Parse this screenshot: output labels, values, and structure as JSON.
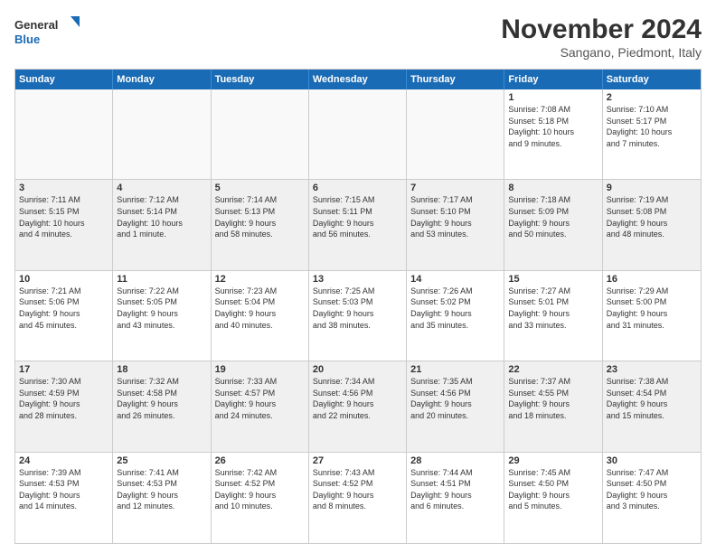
{
  "logo": {
    "line1": "General",
    "line2": "Blue"
  },
  "title": "November 2024",
  "location": "Sangano, Piedmont, Italy",
  "weekdays": [
    "Sunday",
    "Monday",
    "Tuesday",
    "Wednesday",
    "Thursday",
    "Friday",
    "Saturday"
  ],
  "weeks": [
    [
      {
        "day": "",
        "info": ""
      },
      {
        "day": "",
        "info": ""
      },
      {
        "day": "",
        "info": ""
      },
      {
        "day": "",
        "info": ""
      },
      {
        "day": "",
        "info": ""
      },
      {
        "day": "1",
        "info": "Sunrise: 7:08 AM\nSunset: 5:18 PM\nDaylight: 10 hours\nand 9 minutes."
      },
      {
        "day": "2",
        "info": "Sunrise: 7:10 AM\nSunset: 5:17 PM\nDaylight: 10 hours\nand 7 minutes."
      }
    ],
    [
      {
        "day": "3",
        "info": "Sunrise: 7:11 AM\nSunset: 5:15 PM\nDaylight: 10 hours\nand 4 minutes."
      },
      {
        "day": "4",
        "info": "Sunrise: 7:12 AM\nSunset: 5:14 PM\nDaylight: 10 hours\nand 1 minute."
      },
      {
        "day": "5",
        "info": "Sunrise: 7:14 AM\nSunset: 5:13 PM\nDaylight: 9 hours\nand 58 minutes."
      },
      {
        "day": "6",
        "info": "Sunrise: 7:15 AM\nSunset: 5:11 PM\nDaylight: 9 hours\nand 56 minutes."
      },
      {
        "day": "7",
        "info": "Sunrise: 7:17 AM\nSunset: 5:10 PM\nDaylight: 9 hours\nand 53 minutes."
      },
      {
        "day": "8",
        "info": "Sunrise: 7:18 AM\nSunset: 5:09 PM\nDaylight: 9 hours\nand 50 minutes."
      },
      {
        "day": "9",
        "info": "Sunrise: 7:19 AM\nSunset: 5:08 PM\nDaylight: 9 hours\nand 48 minutes."
      }
    ],
    [
      {
        "day": "10",
        "info": "Sunrise: 7:21 AM\nSunset: 5:06 PM\nDaylight: 9 hours\nand 45 minutes."
      },
      {
        "day": "11",
        "info": "Sunrise: 7:22 AM\nSunset: 5:05 PM\nDaylight: 9 hours\nand 43 minutes."
      },
      {
        "day": "12",
        "info": "Sunrise: 7:23 AM\nSunset: 5:04 PM\nDaylight: 9 hours\nand 40 minutes."
      },
      {
        "day": "13",
        "info": "Sunrise: 7:25 AM\nSunset: 5:03 PM\nDaylight: 9 hours\nand 38 minutes."
      },
      {
        "day": "14",
        "info": "Sunrise: 7:26 AM\nSunset: 5:02 PM\nDaylight: 9 hours\nand 35 minutes."
      },
      {
        "day": "15",
        "info": "Sunrise: 7:27 AM\nSunset: 5:01 PM\nDaylight: 9 hours\nand 33 minutes."
      },
      {
        "day": "16",
        "info": "Sunrise: 7:29 AM\nSunset: 5:00 PM\nDaylight: 9 hours\nand 31 minutes."
      }
    ],
    [
      {
        "day": "17",
        "info": "Sunrise: 7:30 AM\nSunset: 4:59 PM\nDaylight: 9 hours\nand 28 minutes."
      },
      {
        "day": "18",
        "info": "Sunrise: 7:32 AM\nSunset: 4:58 PM\nDaylight: 9 hours\nand 26 minutes."
      },
      {
        "day": "19",
        "info": "Sunrise: 7:33 AM\nSunset: 4:57 PM\nDaylight: 9 hours\nand 24 minutes."
      },
      {
        "day": "20",
        "info": "Sunrise: 7:34 AM\nSunset: 4:56 PM\nDaylight: 9 hours\nand 22 minutes."
      },
      {
        "day": "21",
        "info": "Sunrise: 7:35 AM\nSunset: 4:56 PM\nDaylight: 9 hours\nand 20 minutes."
      },
      {
        "day": "22",
        "info": "Sunrise: 7:37 AM\nSunset: 4:55 PM\nDaylight: 9 hours\nand 18 minutes."
      },
      {
        "day": "23",
        "info": "Sunrise: 7:38 AM\nSunset: 4:54 PM\nDaylight: 9 hours\nand 15 minutes."
      }
    ],
    [
      {
        "day": "24",
        "info": "Sunrise: 7:39 AM\nSunset: 4:53 PM\nDaylight: 9 hours\nand 14 minutes."
      },
      {
        "day": "25",
        "info": "Sunrise: 7:41 AM\nSunset: 4:53 PM\nDaylight: 9 hours\nand 12 minutes."
      },
      {
        "day": "26",
        "info": "Sunrise: 7:42 AM\nSunset: 4:52 PM\nDaylight: 9 hours\nand 10 minutes."
      },
      {
        "day": "27",
        "info": "Sunrise: 7:43 AM\nSunset: 4:52 PM\nDaylight: 9 hours\nand 8 minutes."
      },
      {
        "day": "28",
        "info": "Sunrise: 7:44 AM\nSunset: 4:51 PM\nDaylight: 9 hours\nand 6 minutes."
      },
      {
        "day": "29",
        "info": "Sunrise: 7:45 AM\nSunset: 4:50 PM\nDaylight: 9 hours\nand 5 minutes."
      },
      {
        "day": "30",
        "info": "Sunrise: 7:47 AM\nSunset: 4:50 PM\nDaylight: 9 hours\nand 3 minutes."
      }
    ]
  ]
}
